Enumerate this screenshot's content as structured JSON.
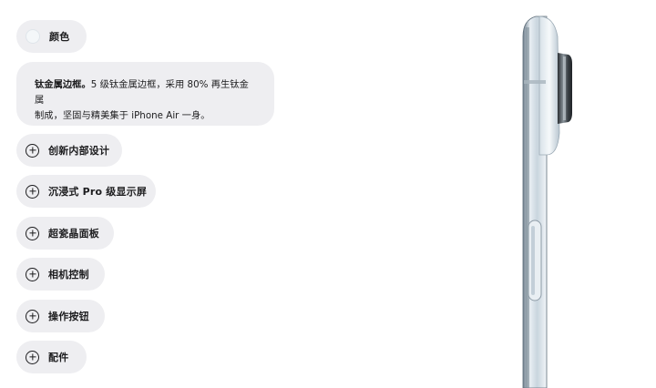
{
  "color_tab": {
    "label": "颜色",
    "swatch_color": "#f4f7f9"
  },
  "expanded_item": {
    "title": "钛金属边框。",
    "line1_rest": "5 级钛金属边框，采用 80% 再生钛金属",
    "line2": "制成，坚固与精美集于 iPhone Air 一身。"
  },
  "menu": {
    "items": [
      {
        "label": "创新内部设计"
      },
      {
        "label": "沉浸式 Pro 级显示屏"
      },
      {
        "label": "超瓷晶面板"
      },
      {
        "label": "相机控制"
      },
      {
        "label": "操作按钮"
      },
      {
        "label": "配件"
      }
    ]
  },
  "colors": {
    "pill_bg": "#eeeef1",
    "text": "#1d1d1f",
    "phone_frame": "#dfe8ef"
  }
}
